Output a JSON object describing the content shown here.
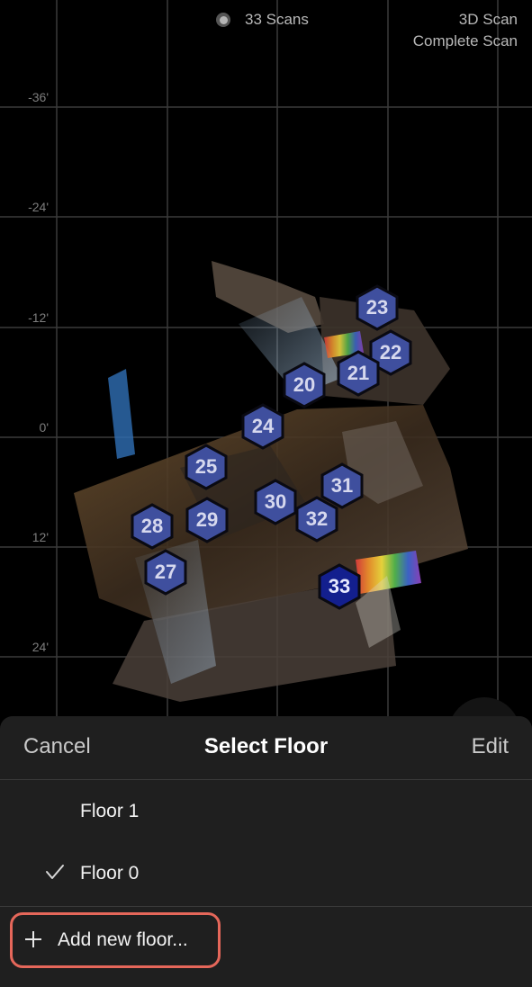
{
  "status": {
    "scan_count": "33 Scans",
    "mode_line1": "3D Scan",
    "mode_line2": "Complete Scan"
  },
  "map": {
    "grid_labels": [
      "-36'",
      "-24'",
      "-12'",
      "0'",
      "12'",
      "24'"
    ],
    "markers": [
      {
        "label": "23",
        "active": false
      },
      {
        "label": "22",
        "active": false
      },
      {
        "label": "21",
        "active": false
      },
      {
        "label": "20",
        "active": false
      },
      {
        "label": "24",
        "active": false
      },
      {
        "label": "25",
        "active": false
      },
      {
        "label": "31",
        "active": false
      },
      {
        "label": "30",
        "active": false
      },
      {
        "label": "32",
        "active": false
      },
      {
        "label": "28",
        "active": false
      },
      {
        "label": "29",
        "active": false
      },
      {
        "label": "27",
        "active": false
      },
      {
        "label": "33",
        "active": true
      }
    ],
    "colors": {
      "marker_fill": "#3f4f9e",
      "marker_active_fill": "#131f8e",
      "marker_border": "#0a0a12",
      "grid": "#3a3a3a"
    }
  },
  "sheet": {
    "cancel_label": "Cancel",
    "title": "Select Floor",
    "edit_label": "Edit",
    "floors": [
      {
        "label": "Floor 1",
        "selected": false
      },
      {
        "label": "Floor 0",
        "selected": true
      }
    ],
    "add_floor_label": "Add new floor...",
    "icons": {
      "check": "checkmark-icon",
      "add": "plus-icon"
    },
    "colors": {
      "highlight": "#e5675a",
      "background": "#1f1f1f"
    }
  }
}
